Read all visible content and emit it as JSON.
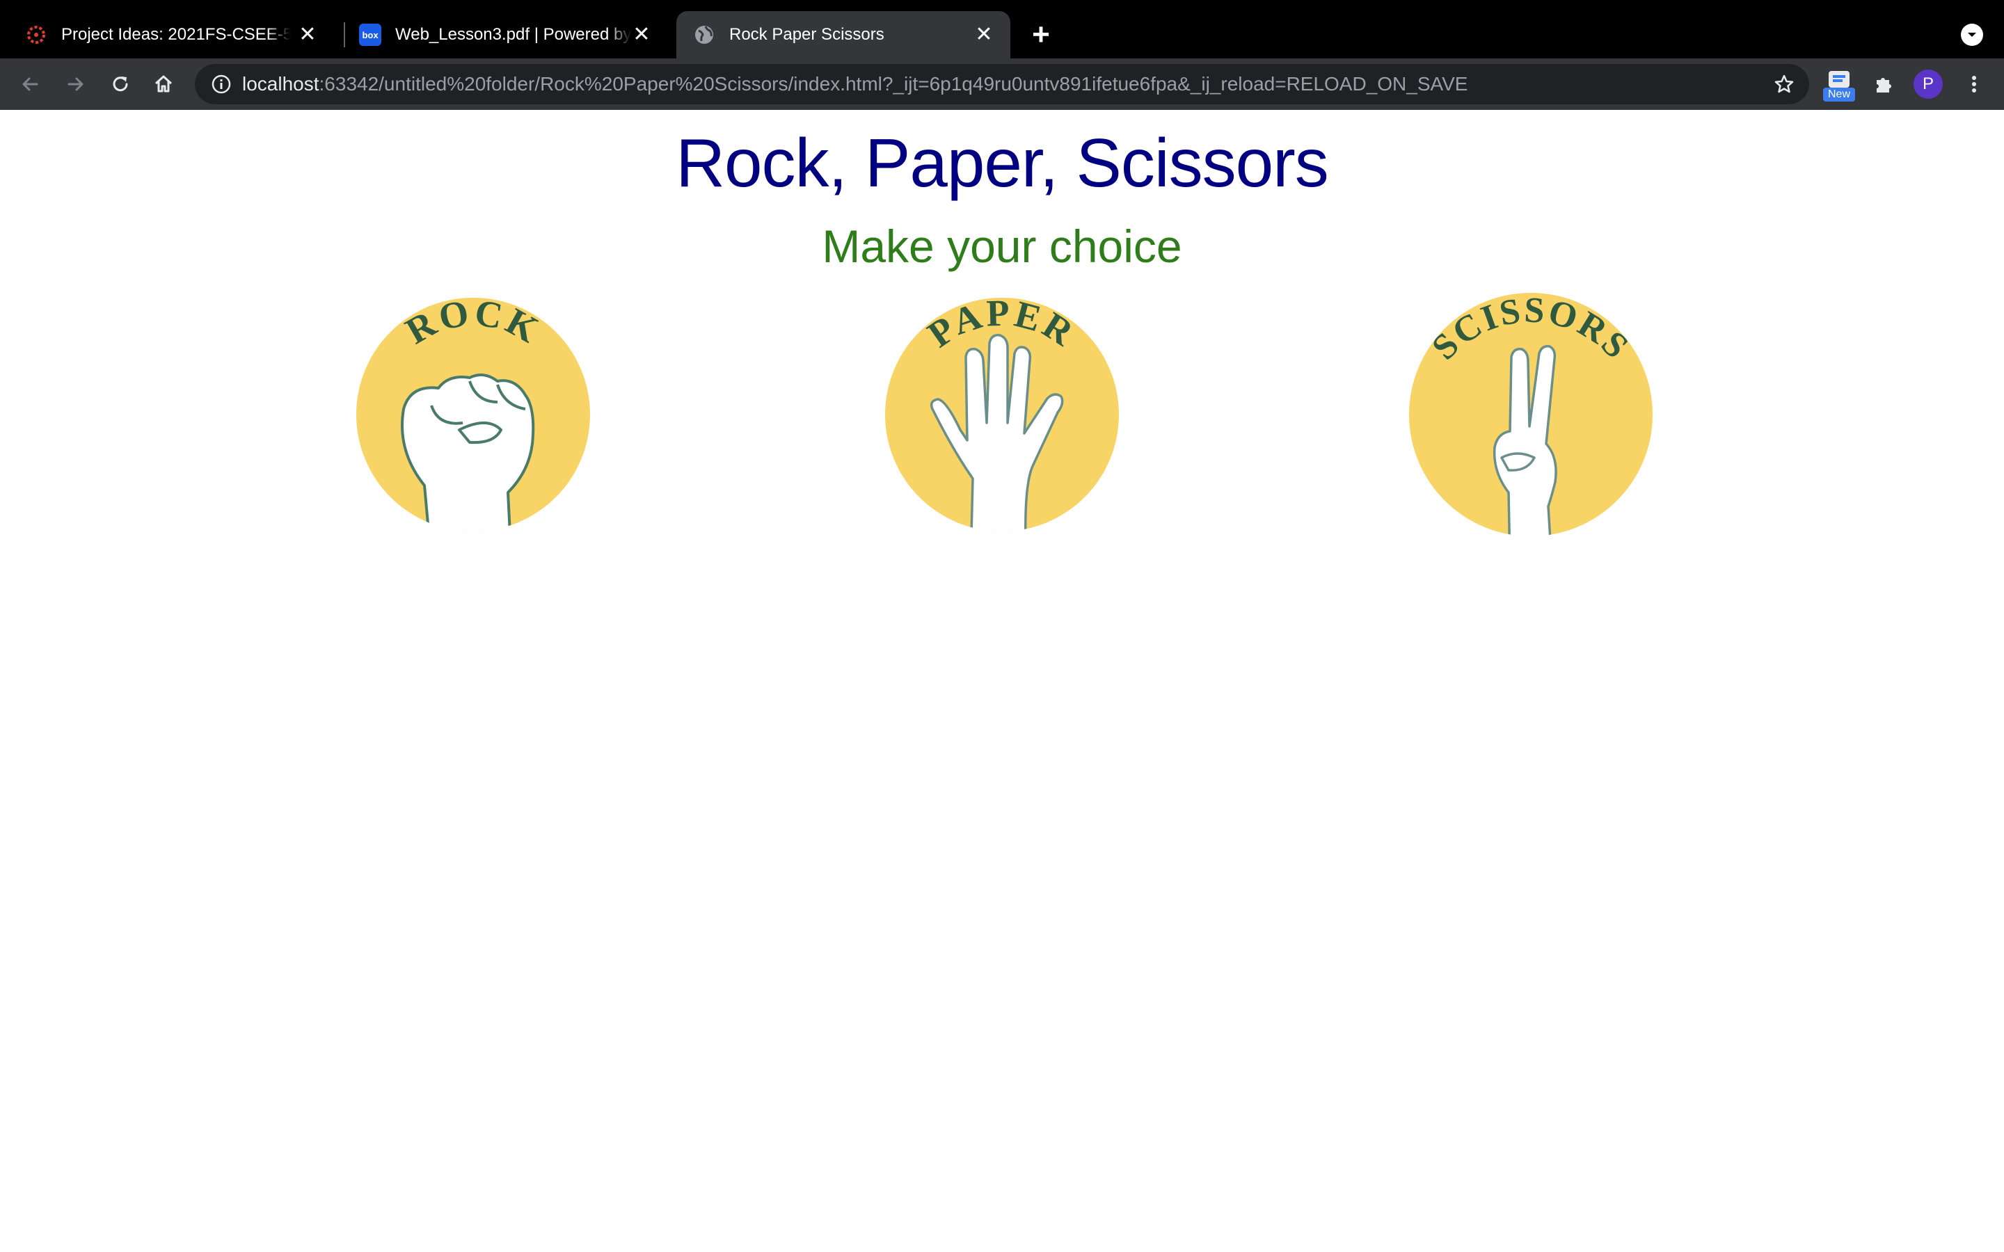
{
  "browser": {
    "tabs": [
      {
        "title": "Project Ideas: 2021FS-CSEE-5",
        "favicon": "canvas-logo-icon",
        "active": false
      },
      {
        "title": "Web_Lesson3.pdf | Powered by",
        "favicon": "box-logo-icon",
        "favicon_text": "box",
        "active": false
      },
      {
        "title": "Rock Paper Scissors",
        "favicon": "globe-icon",
        "active": true
      }
    ],
    "close_glyph": "✕",
    "new_tab_glyph": "+",
    "address": {
      "host": "localhost",
      "rest": ":63342/untitled%20folder/Rock%20Paper%20Scissors/index.html?_ijt=6p1q49ru0untv891ifetue6fpa&_ij_reload=RELOAD_ON_SAVE"
    },
    "extension_badge": "New",
    "profile_initial": "P",
    "colors": {
      "tabstrip": "#000000",
      "toolbar": "#35363a",
      "omnibox": "#202124",
      "avatar": "#5b35c8"
    }
  },
  "page": {
    "title": "Rock, Paper, Scissors",
    "subtitle": "Make your choice",
    "choices": [
      {
        "label": "ROCK",
        "icon": "rock-fist-icon"
      },
      {
        "label": "PAPER",
        "icon": "paper-hand-icon"
      },
      {
        "label": "SCISSORS",
        "icon": "scissors-peace-icon"
      }
    ],
    "colors": {
      "title": "#000080",
      "subtitle": "#2e7d1a",
      "circle": "#f8d466",
      "label": "#2f5a40"
    }
  }
}
